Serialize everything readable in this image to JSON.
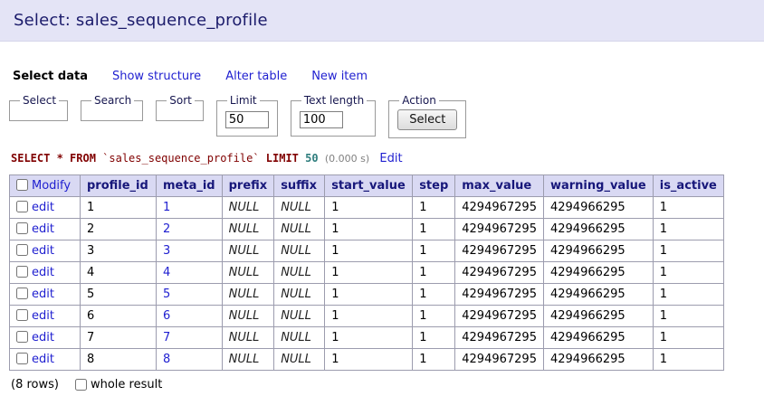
{
  "header": {
    "title": "Select: sales_sequence_profile"
  },
  "nav": {
    "select_data": "Select data",
    "show_structure": "Show structure",
    "alter_table": "Alter table",
    "new_item": "New item"
  },
  "fieldsets": {
    "select": "Select",
    "search": "Search",
    "sort": "Sort",
    "limit": "Limit",
    "limit_value": "50",
    "text_length": "Text length",
    "text_length_value": "100",
    "action": "Action",
    "action_button": "Select"
  },
  "query": {
    "select_from": "SELECT * FROM",
    "table_name": "`sales_sequence_profile`",
    "limit_kw": "LIMIT",
    "limit_num": "50",
    "time": "(0.000 s)",
    "edit_link": "Edit"
  },
  "table": {
    "modify_header": "Modify",
    "edit_label": "edit",
    "headers": [
      "profile_id",
      "meta_id",
      "prefix",
      "suffix",
      "start_value",
      "step",
      "max_value",
      "warning_value",
      "is_active"
    ],
    "rows": [
      {
        "profile_id": "1",
        "meta_id": "1",
        "prefix": "NULL",
        "suffix": "NULL",
        "start_value": "1",
        "step": "1",
        "max_value": "4294967295",
        "warning_value": "4294966295",
        "is_active": "1"
      },
      {
        "profile_id": "2",
        "meta_id": "2",
        "prefix": "NULL",
        "suffix": "NULL",
        "start_value": "1",
        "step": "1",
        "max_value": "4294967295",
        "warning_value": "4294966295",
        "is_active": "1"
      },
      {
        "profile_id": "3",
        "meta_id": "3",
        "prefix": "NULL",
        "suffix": "NULL",
        "start_value": "1",
        "step": "1",
        "max_value": "4294967295",
        "warning_value": "4294966295",
        "is_active": "1"
      },
      {
        "profile_id": "4",
        "meta_id": "4",
        "prefix": "NULL",
        "suffix": "NULL",
        "start_value": "1",
        "step": "1",
        "max_value": "4294967295",
        "warning_value": "4294966295",
        "is_active": "1"
      },
      {
        "profile_id": "5",
        "meta_id": "5",
        "prefix": "NULL",
        "suffix": "NULL",
        "start_value": "1",
        "step": "1",
        "max_value": "4294967295",
        "warning_value": "4294966295",
        "is_active": "1"
      },
      {
        "profile_id": "6",
        "meta_id": "6",
        "prefix": "NULL",
        "suffix": "NULL",
        "start_value": "1",
        "step": "1",
        "max_value": "4294967295",
        "warning_value": "4294966295",
        "is_active": "1"
      },
      {
        "profile_id": "7",
        "meta_id": "7",
        "prefix": "NULL",
        "suffix": "NULL",
        "start_value": "1",
        "step": "1",
        "max_value": "4294967295",
        "warning_value": "4294966295",
        "is_active": "1"
      },
      {
        "profile_id": "8",
        "meta_id": "8",
        "prefix": "NULL",
        "suffix": "NULL",
        "start_value": "1",
        "step": "1",
        "max_value": "4294967295",
        "warning_value": "4294966295",
        "is_active": "1"
      }
    ]
  },
  "footer": {
    "row_count": "(8 rows)",
    "whole_result_label": "whole result"
  }
}
